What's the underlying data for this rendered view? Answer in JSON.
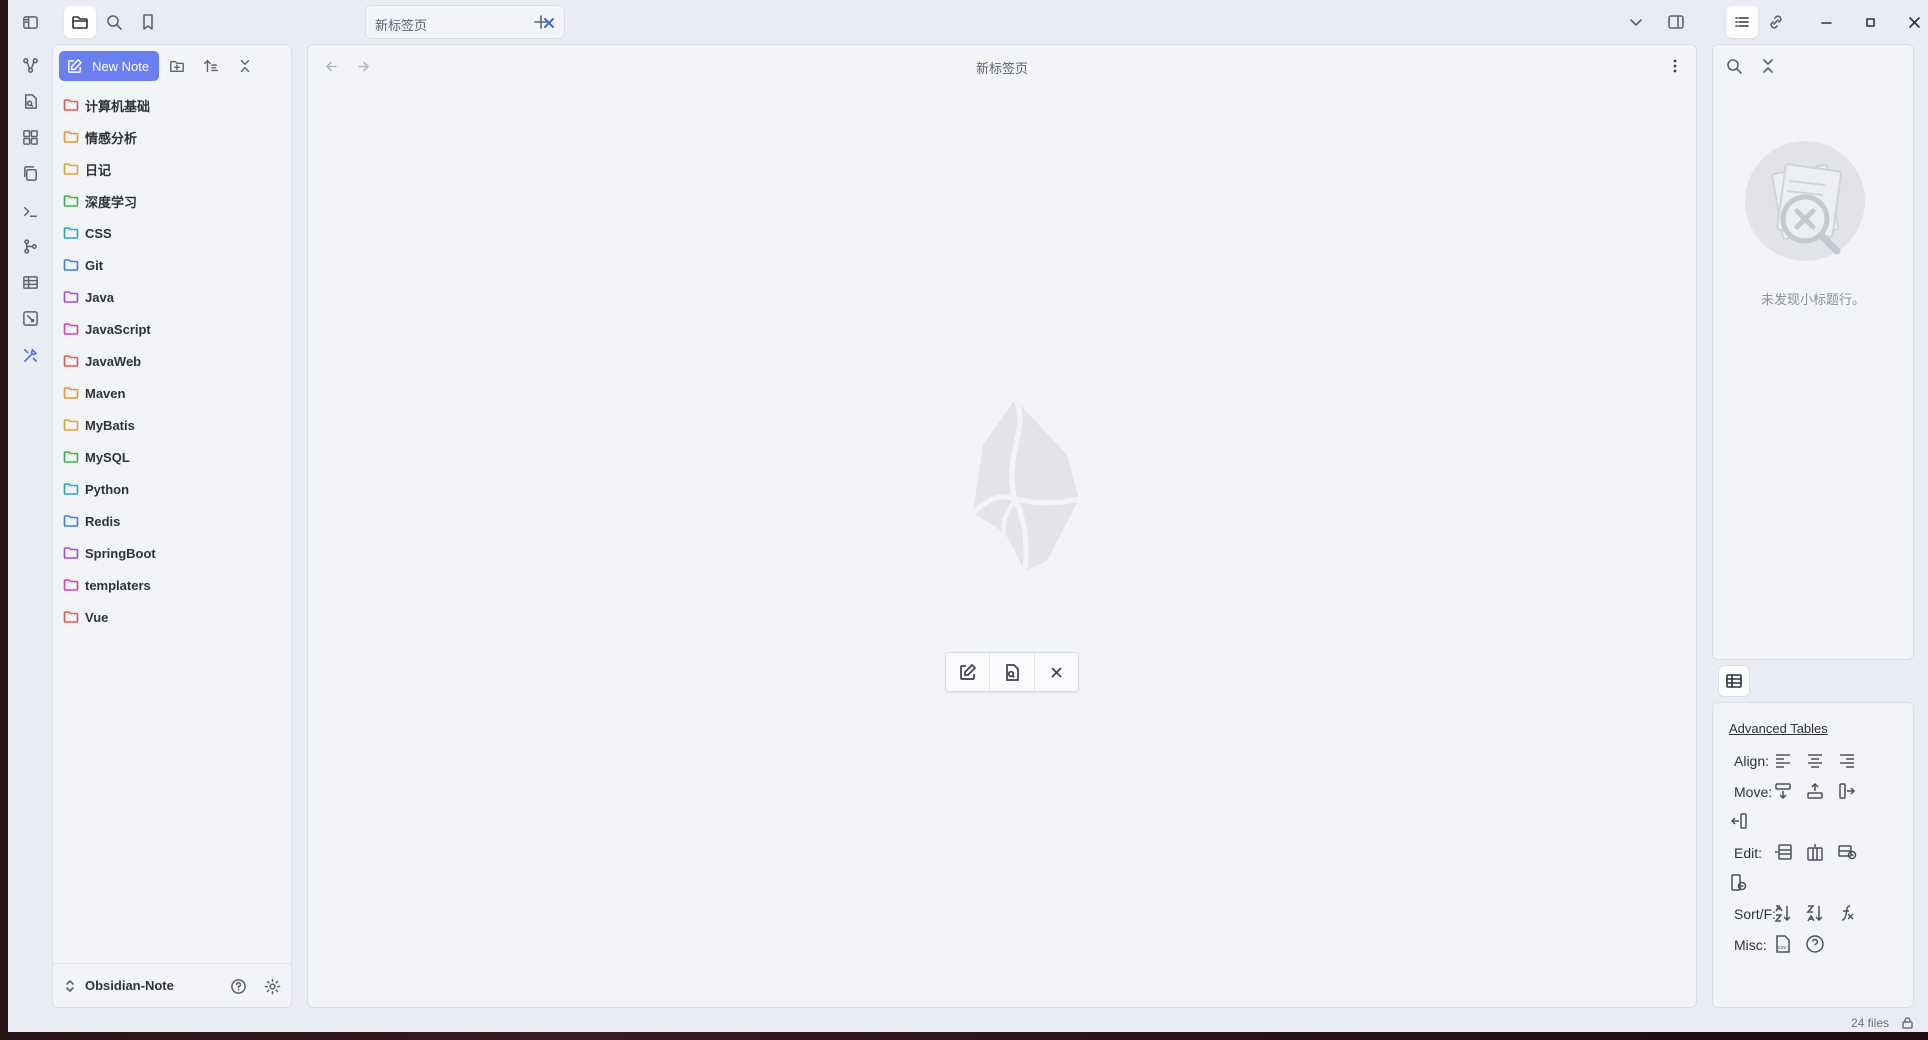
{
  "tabs": [
    {
      "title": "新标签页"
    }
  ],
  "main": {
    "view_title": "新标签页"
  },
  "explorer": {
    "new_note_label": "New Note",
    "folders": [
      {
        "name": "计算机基础",
        "color": "#e05757"
      },
      {
        "name": "情感分析",
        "color": "#e8913a"
      },
      {
        "name": "日记",
        "color": "#d8a52d"
      },
      {
        "name": "深度学习",
        "color": "#3fae4f"
      },
      {
        "name": "CSS",
        "color": "#29a7b8"
      },
      {
        "name": "Git",
        "color": "#3d7fd8"
      },
      {
        "name": "Java",
        "color": "#9b4fd1"
      },
      {
        "name": "JavaScript",
        "color": "#d146a6"
      },
      {
        "name": "JavaWeb",
        "color": "#e05757"
      },
      {
        "name": "Maven",
        "color": "#e8913a"
      },
      {
        "name": "MyBatis",
        "color": "#d8a52d"
      },
      {
        "name": "MySQL",
        "color": "#3fae4f"
      },
      {
        "name": "Python",
        "color": "#29a7b8"
      },
      {
        "name": "Redis",
        "color": "#3d7fd8"
      },
      {
        "name": "SpringBoot",
        "color": "#9b4fd1"
      },
      {
        "name": "templaters",
        "color": "#d146a6"
      },
      {
        "name": "Vue",
        "color": "#e05757"
      }
    ],
    "vault_name": "Obsidian-Note"
  },
  "outline": {
    "empty_text": "未发现小标题行。"
  },
  "advanced_tables": {
    "title": "Advanced Tables",
    "align_label": "Align:",
    "move_label": "Move:",
    "edit_label": "Edit:",
    "sort_label": "Sort/F:",
    "misc_label": "Misc:"
  },
  "status": {
    "files": "24 files"
  },
  "colors": {
    "accent": "#6a7ff0",
    "background": "#e9ecf3",
    "panel": "#f3f4f8"
  }
}
